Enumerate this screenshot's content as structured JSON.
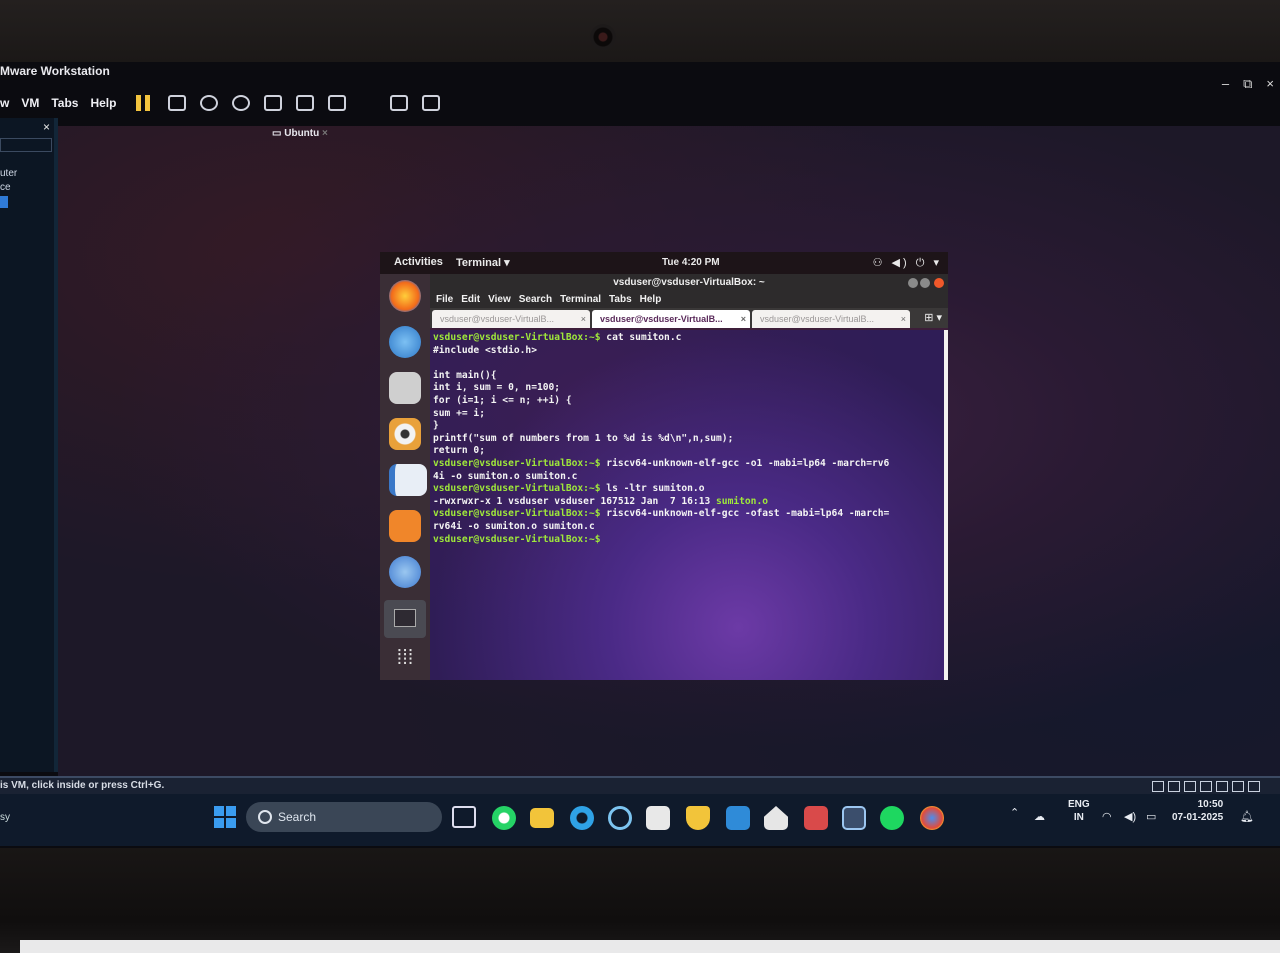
{
  "vmware": {
    "title": "Mware Workstation",
    "menu": [
      "w",
      "VM",
      "Tabs",
      "Help"
    ],
    "tabs": [
      "",
      "",
      "Ubuntu"
    ],
    "sidebar_labels": [
      "uter",
      "ce"
    ],
    "status_text": "is VM, click inside or press Ctrl+G."
  },
  "taskbar": {
    "left_text": "sy",
    "search_placeholder": "Search",
    "language": "ENG",
    "region": "IN",
    "time": "10:50",
    "date": "07-01-2025"
  },
  "ubuntu": {
    "activities": "Activities",
    "app_menu": "Terminal ▾",
    "clock": "Tue  4:20 PM",
    "window_title": "vsduser@vsduser-VirtualBox: ~",
    "menu": [
      "File",
      "Edit",
      "View",
      "Search",
      "Terminal",
      "Tabs",
      "Help"
    ],
    "tabs": [
      "vsduser@vsduser-VirtualB...",
      "vsduser@vsduser-VirtualB...",
      "vsduser@vsduser-VirtualB..."
    ]
  },
  "terminal_lines": [
    {
      "prompt": "vsduser@vsduser-VirtualBox:~$",
      "text": " cat sumiton.c"
    },
    {
      "prompt": "",
      "text": "#include <stdio.h>"
    },
    {
      "prompt": "",
      "text": " "
    },
    {
      "prompt": "",
      "text": "int main(){"
    },
    {
      "prompt": "",
      "text": "int i, sum = 0, n=100;"
    },
    {
      "prompt": "",
      "text": "for (i=1; i <= n; ++i) {"
    },
    {
      "prompt": "",
      "text": "sum += i;"
    },
    {
      "prompt": "",
      "text": "}"
    },
    {
      "prompt": "",
      "text": "printf(\"sum of numbers from 1 to %d is %d\\n\",n,sum);"
    },
    {
      "prompt": "",
      "text": "return 0;"
    },
    {
      "prompt": "vsduser@vsduser-VirtualBox:~$",
      "text": " riscv64-unknown-elf-gcc -o1 -mabi=lp64 -march=rv6"
    },
    {
      "prompt": "",
      "text": "4i -o sumiton.o sumiton.c"
    },
    {
      "prompt": "vsduser@vsduser-VirtualBox:~$",
      "text": " ls -ltr sumiton.o"
    },
    {
      "prompt": "",
      "text": "-rwxrwxr-x 1 vsduser vsduser 167512 Jan  7 16:13 ",
      "highlight": "sumiton.o"
    },
    {
      "prompt": "vsduser@vsduser-VirtualBox:~$",
      "text": " riscv64-unknown-elf-gcc -ofast -mabi=lp64 -march="
    },
    {
      "prompt": "",
      "text": "rv64i -o sumiton.o sumiton.c"
    },
    {
      "prompt": "vsduser@vsduser-VirtualBox:~$",
      "text": ""
    }
  ]
}
